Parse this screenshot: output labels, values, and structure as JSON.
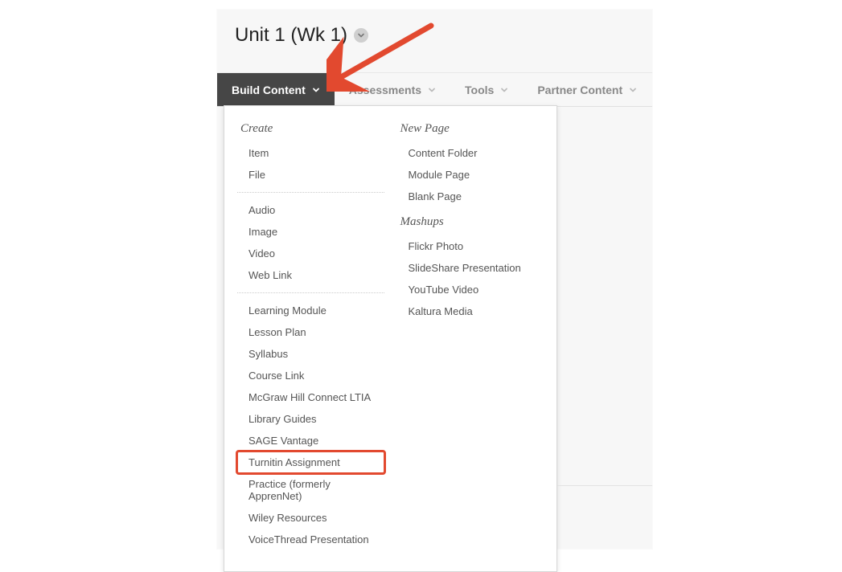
{
  "page": {
    "title": "Unit 1 (Wk 1)"
  },
  "actionbar": {
    "tabs": [
      {
        "key": "build",
        "label": "Build Content",
        "active": true
      },
      {
        "key": "assess",
        "label": "Assessments",
        "active": false
      },
      {
        "key": "tools",
        "label": "Tools",
        "active": false
      },
      {
        "key": "partner",
        "label": "Partner Content",
        "active": false
      }
    ]
  },
  "dropdown": {
    "left": {
      "heading": "Create",
      "group1": [
        {
          "label": "Item"
        },
        {
          "label": "File"
        }
      ],
      "group2": [
        {
          "label": "Audio"
        },
        {
          "label": "Image"
        },
        {
          "label": "Video"
        },
        {
          "label": "Web Link"
        }
      ],
      "group3": [
        {
          "label": "Learning Module"
        },
        {
          "label": "Lesson Plan"
        },
        {
          "label": "Syllabus"
        },
        {
          "label": "Course Link"
        },
        {
          "label": "McGraw Hill Connect LTIA"
        },
        {
          "label": "Library Guides"
        },
        {
          "label": "SAGE Vantage"
        },
        {
          "label": "Turnitin Assignment",
          "highlight": true
        },
        {
          "label": "Practice (formerly ApprenNet)"
        },
        {
          "label": "Wiley Resources"
        },
        {
          "label": "VoiceThread Presentation"
        }
      ]
    },
    "right": {
      "heading_newpage": "New Page",
      "newpage_items": [
        {
          "label": "Content Folder"
        },
        {
          "label": "Module Page"
        },
        {
          "label": "Blank Page"
        }
      ],
      "heading_mashups": "Mashups",
      "mashup_items": [
        {
          "label": "Flickr Photo"
        },
        {
          "label": "SlideShare Presentation"
        },
        {
          "label": "YouTube Video"
        },
        {
          "label": "Kaltura Media"
        }
      ]
    }
  },
  "annotation": {
    "arrow_color": "#e2492f",
    "highlight_color": "#e2492f"
  }
}
